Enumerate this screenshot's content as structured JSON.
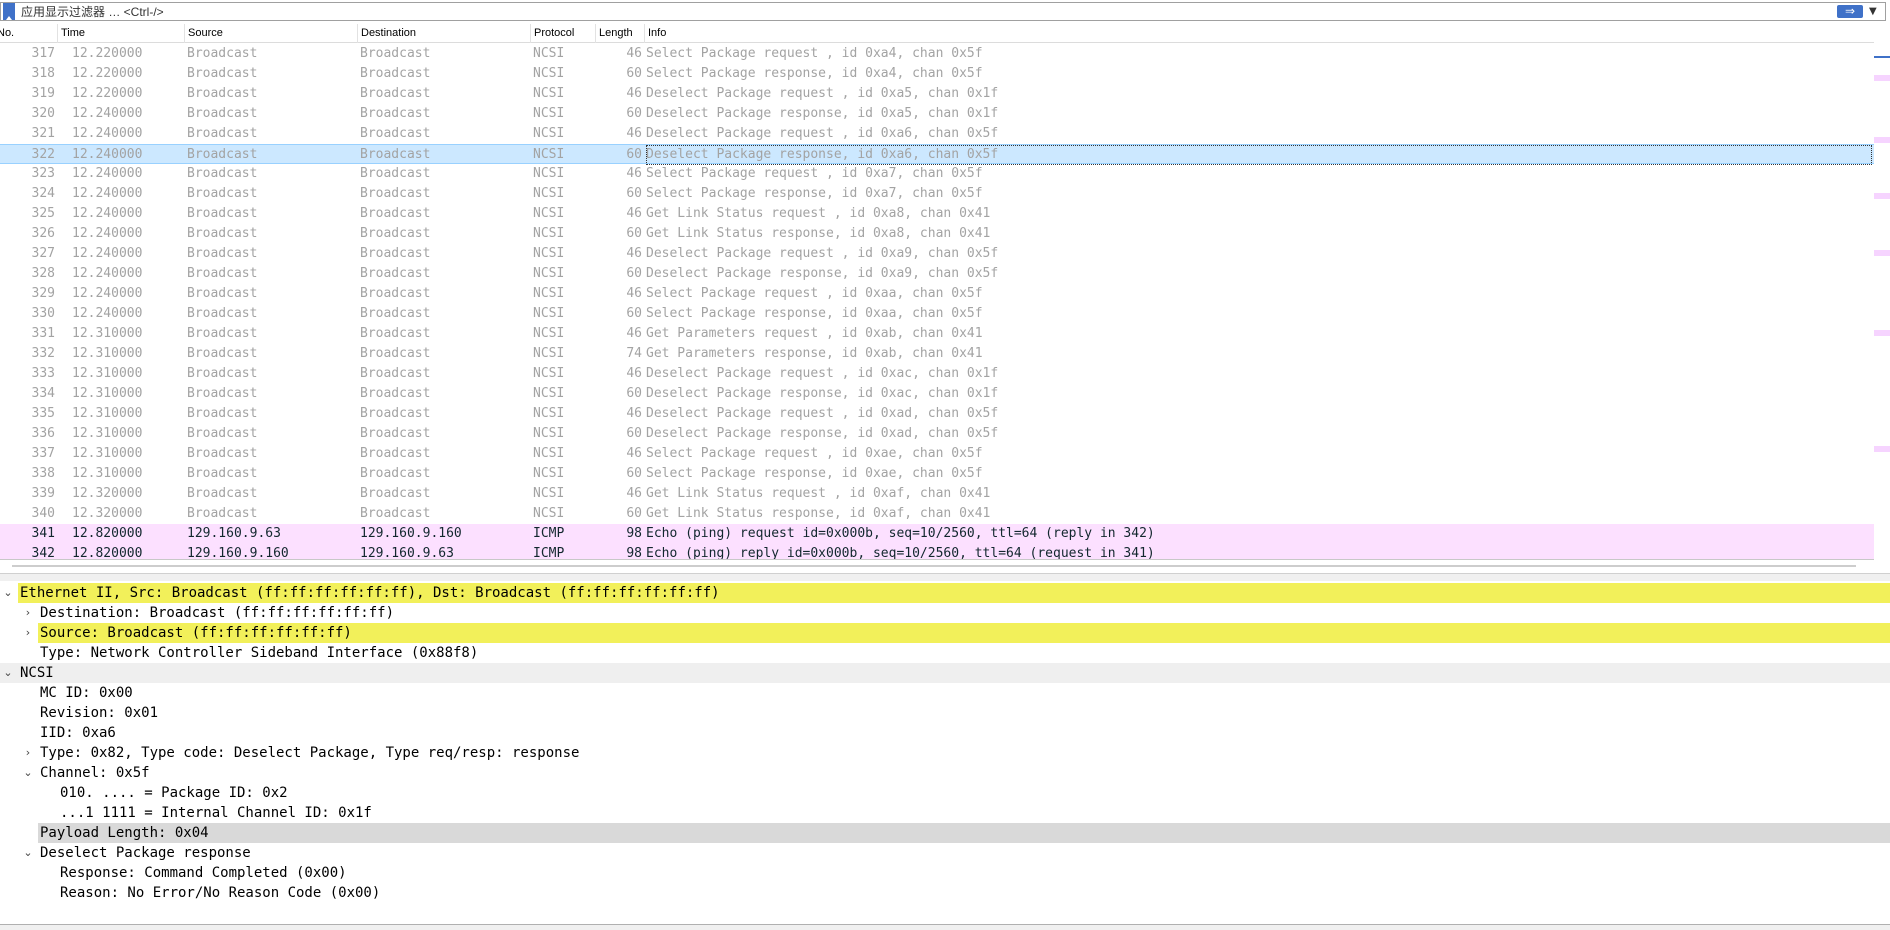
{
  "filter": {
    "placeholder": "应用显示过滤器 … <Ctrl-/>",
    "apply_icon": "arrow-right-icon",
    "bookmark_icon": "bookmark-icon"
  },
  "packet_list": {
    "columns": [
      "No.",
      "Time",
      "Source",
      "Destination",
      "Protocol",
      "Length",
      "Info"
    ],
    "rows": [
      {
        "no": "317",
        "time": "12.220000",
        "src": "Broadcast",
        "dst": "Broadcast",
        "proto": "NCSI",
        "len": "46",
        "info": "Select Package request , id 0xa4, chan 0x5f"
      },
      {
        "no": "318",
        "time": "12.220000",
        "src": "Broadcast",
        "dst": "Broadcast",
        "proto": "NCSI",
        "len": "60",
        "info": "Select Package response, id 0xa4, chan 0x5f"
      },
      {
        "no": "319",
        "time": "12.220000",
        "src": "Broadcast",
        "dst": "Broadcast",
        "proto": "NCSI",
        "len": "46",
        "info": "Deselect Package request , id 0xa5, chan 0x1f"
      },
      {
        "no": "320",
        "time": "12.240000",
        "src": "Broadcast",
        "dst": "Broadcast",
        "proto": "NCSI",
        "len": "60",
        "info": "Deselect Package response, id 0xa5, chan 0x1f"
      },
      {
        "no": "321",
        "time": "12.240000",
        "src": "Broadcast",
        "dst": "Broadcast",
        "proto": "NCSI",
        "len": "46",
        "info": "Deselect Package request , id 0xa6, chan 0x5f"
      },
      {
        "no": "322",
        "time": "12.240000",
        "src": "Broadcast",
        "dst": "Broadcast",
        "proto": "NCSI",
        "len": "60",
        "info": "Deselect Package response, id 0xa6, chan 0x5f",
        "selected": true
      },
      {
        "no": "323",
        "time": "12.240000",
        "src": "Broadcast",
        "dst": "Broadcast",
        "proto": "NCSI",
        "len": "46",
        "info": "Select Package request , id 0xa7, chan 0x5f"
      },
      {
        "no": "324",
        "time": "12.240000",
        "src": "Broadcast",
        "dst": "Broadcast",
        "proto": "NCSI",
        "len": "60",
        "info": "Select Package response, id 0xa7, chan 0x5f"
      },
      {
        "no": "325",
        "time": "12.240000",
        "src": "Broadcast",
        "dst": "Broadcast",
        "proto": "NCSI",
        "len": "46",
        "info": "Get Link Status request , id 0xa8, chan 0x41"
      },
      {
        "no": "326",
        "time": "12.240000",
        "src": "Broadcast",
        "dst": "Broadcast",
        "proto": "NCSI",
        "len": "60",
        "info": "Get Link Status response, id 0xa8, chan 0x41"
      },
      {
        "no": "327",
        "time": "12.240000",
        "src": "Broadcast",
        "dst": "Broadcast",
        "proto": "NCSI",
        "len": "46",
        "info": "Deselect Package request , id 0xa9, chan 0x5f"
      },
      {
        "no": "328",
        "time": "12.240000",
        "src": "Broadcast",
        "dst": "Broadcast",
        "proto": "NCSI",
        "len": "60",
        "info": "Deselect Package response, id 0xa9, chan 0x5f"
      },
      {
        "no": "329",
        "time": "12.240000",
        "src": "Broadcast",
        "dst": "Broadcast",
        "proto": "NCSI",
        "len": "46",
        "info": "Select Package request , id 0xaa, chan 0x5f"
      },
      {
        "no": "330",
        "time": "12.240000",
        "src": "Broadcast",
        "dst": "Broadcast",
        "proto": "NCSI",
        "len": "60",
        "info": "Select Package response, id 0xaa, chan 0x5f"
      },
      {
        "no": "331",
        "time": "12.310000",
        "src": "Broadcast",
        "dst": "Broadcast",
        "proto": "NCSI",
        "len": "46",
        "info": "Get Parameters request , id 0xab, chan 0x41"
      },
      {
        "no": "332",
        "time": "12.310000",
        "src": "Broadcast",
        "dst": "Broadcast",
        "proto": "NCSI",
        "len": "74",
        "info": "Get Parameters response, id 0xab, chan 0x41"
      },
      {
        "no": "333",
        "time": "12.310000",
        "src": "Broadcast",
        "dst": "Broadcast",
        "proto": "NCSI",
        "len": "46",
        "info": "Deselect Package request , id 0xac, chan 0x1f"
      },
      {
        "no": "334",
        "time": "12.310000",
        "src": "Broadcast",
        "dst": "Broadcast",
        "proto": "NCSI",
        "len": "60",
        "info": "Deselect Package response, id 0xac, chan 0x1f"
      },
      {
        "no": "335",
        "time": "12.310000",
        "src": "Broadcast",
        "dst": "Broadcast",
        "proto": "NCSI",
        "len": "46",
        "info": "Deselect Package request , id 0xad, chan 0x5f"
      },
      {
        "no": "336",
        "time": "12.310000",
        "src": "Broadcast",
        "dst": "Broadcast",
        "proto": "NCSI",
        "len": "60",
        "info": "Deselect Package response, id 0xad, chan 0x5f"
      },
      {
        "no": "337",
        "time": "12.310000",
        "src": "Broadcast",
        "dst": "Broadcast",
        "proto": "NCSI",
        "len": "46",
        "info": "Select Package request , id 0xae, chan 0x5f"
      },
      {
        "no": "338",
        "time": "12.310000",
        "src": "Broadcast",
        "dst": "Broadcast",
        "proto": "NCSI",
        "len": "60",
        "info": "Select Package response, id 0xae, chan 0x5f"
      },
      {
        "no": "339",
        "time": "12.320000",
        "src": "Broadcast",
        "dst": "Broadcast",
        "proto": "NCSI",
        "len": "46",
        "info": "Get Link Status request , id 0xaf, chan 0x41"
      },
      {
        "no": "340",
        "time": "12.320000",
        "src": "Broadcast",
        "dst": "Broadcast",
        "proto": "NCSI",
        "len": "60",
        "info": "Get Link Status response, id 0xaf, chan 0x41"
      },
      {
        "no": "341",
        "time": "12.820000",
        "src": "129.160.9.63",
        "dst": "129.160.9.160",
        "proto": "ICMP",
        "len": "98",
        "info": "Echo (ping) request  id=0x000b, seq=10/2560, ttl=64 (reply in 342)",
        "icmp": true
      },
      {
        "no": "342",
        "time": "12.820000",
        "src": "129.160.9.160",
        "dst": "129.160.9.63",
        "proto": "ICMP",
        "len": "98",
        "info": "Echo (ping) reply    id=0x000b, seq=10/2560, ttl=64 (request in 341)",
        "icmp": true
      }
    ]
  },
  "details": [
    {
      "text": "Ethernet II, Src: Broadcast (ff:ff:ff:ff:ff:ff), Dst: Broadcast (ff:ff:ff:ff:ff:ff)",
      "level": 0,
      "arrow": "expanded",
      "style": "hl"
    },
    {
      "text": "Destination: Broadcast (ff:ff:ff:ff:ff:ff)",
      "level": 1,
      "arrow": "collapsed"
    },
    {
      "text": "Source: Broadcast (ff:ff:ff:ff:ff:ff)",
      "level": 1,
      "arrow": "collapsed",
      "style": "hl"
    },
    {
      "text": "Type: Network Controller Sideband Interface (0x88f8)",
      "level": 1,
      "arrow": "none"
    },
    {
      "text": "NCSI",
      "level": 0,
      "arrow": "expanded",
      "style": "section"
    },
    {
      "text": "MC ID: 0x00",
      "level": 1,
      "arrow": "none"
    },
    {
      "text": "Revision: 0x01",
      "level": 1,
      "arrow": "none"
    },
    {
      "text": "IID: 0xa6",
      "level": 1,
      "arrow": "none"
    },
    {
      "text": "Type: 0x82, Type code: Deselect Package, Type req/resp: response",
      "level": 1,
      "arrow": "collapsed"
    },
    {
      "text": "Channel: 0x5f",
      "level": 1,
      "arrow": "expanded"
    },
    {
      "text": "010. .... = Package ID: 0x2",
      "level": 2,
      "arrow": "none"
    },
    {
      "text": "...1 1111 = Internal Channel ID: 0x1f",
      "level": 2,
      "arrow": "none"
    },
    {
      "text": "Payload Length: 0x04",
      "level": 1,
      "arrow": "none",
      "style": "gray"
    },
    {
      "text": "Deselect Package response",
      "level": 1,
      "arrow": "expanded"
    },
    {
      "text": "Response: Command Completed (0x00)",
      "level": 2,
      "arrow": "none"
    },
    {
      "text": "Reason: No Error/No Reason Code (0x00)",
      "level": 2,
      "arrow": "none"
    }
  ],
  "icons": {
    "expanded": "chevron-down-icon",
    "collapsed": "chevron-right-icon"
  },
  "colors": {
    "selected_row": "#cce8ff",
    "icmp_row": "#fce0ff",
    "highlight": "#f2f05a",
    "accent": "#3f71c8"
  }
}
